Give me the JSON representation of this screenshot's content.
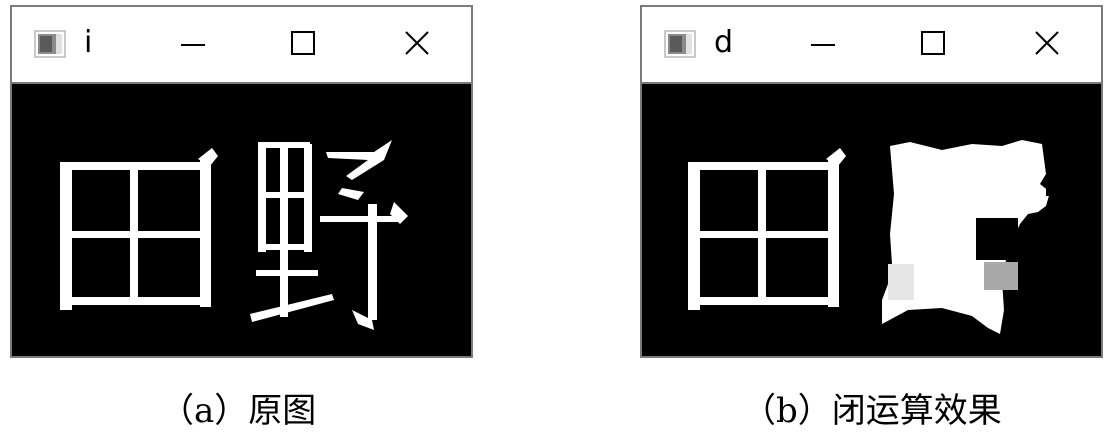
{
  "windows": [
    {
      "title": "i",
      "controls": {
        "minimize": "minimize-icon",
        "maximize": "maximize-icon",
        "close": "close-icon"
      },
      "caption": "（a）原图",
      "image_text": "田野"
    },
    {
      "title": "d",
      "controls": {
        "minimize": "minimize-icon",
        "maximize": "maximize-icon",
        "close": "close-icon"
      },
      "caption": "（b）闭运算效果",
      "image_text": "田"
    }
  ],
  "colors": {
    "frame": "#7a7a7a",
    "canvas": "#000000",
    "glyph": "#ffffff",
    "titlebar": "#ffffff"
  }
}
